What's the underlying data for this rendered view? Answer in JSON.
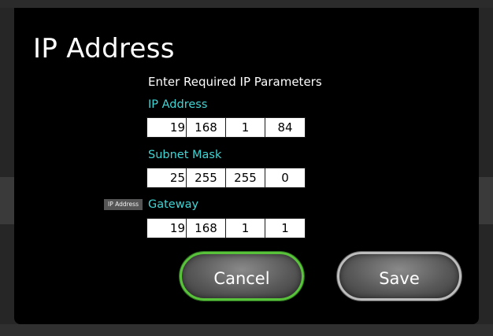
{
  "dialog": {
    "title": "IP Address",
    "subtitle": "Enter Required IP Parameters"
  },
  "fields": {
    "ip_address": {
      "label": "IP Address",
      "octets": [
        "19",
        "168",
        "1",
        "84"
      ]
    },
    "subnet_mask": {
      "label": "Subnet Mask",
      "octets": [
        "25",
        "255",
        "255",
        "0"
      ]
    },
    "gateway": {
      "label": "Gateway",
      "octets": [
        "19",
        "168",
        "1",
        "1"
      ]
    }
  },
  "tooltip": {
    "text": "IP Address"
  },
  "buttons": {
    "cancel_label": "Cancel",
    "save_label": "Save"
  },
  "colors": {
    "label_accent": "#3fd6d6",
    "cancel_focus_ring": "#58c33a",
    "dialog_background": "#000000"
  }
}
